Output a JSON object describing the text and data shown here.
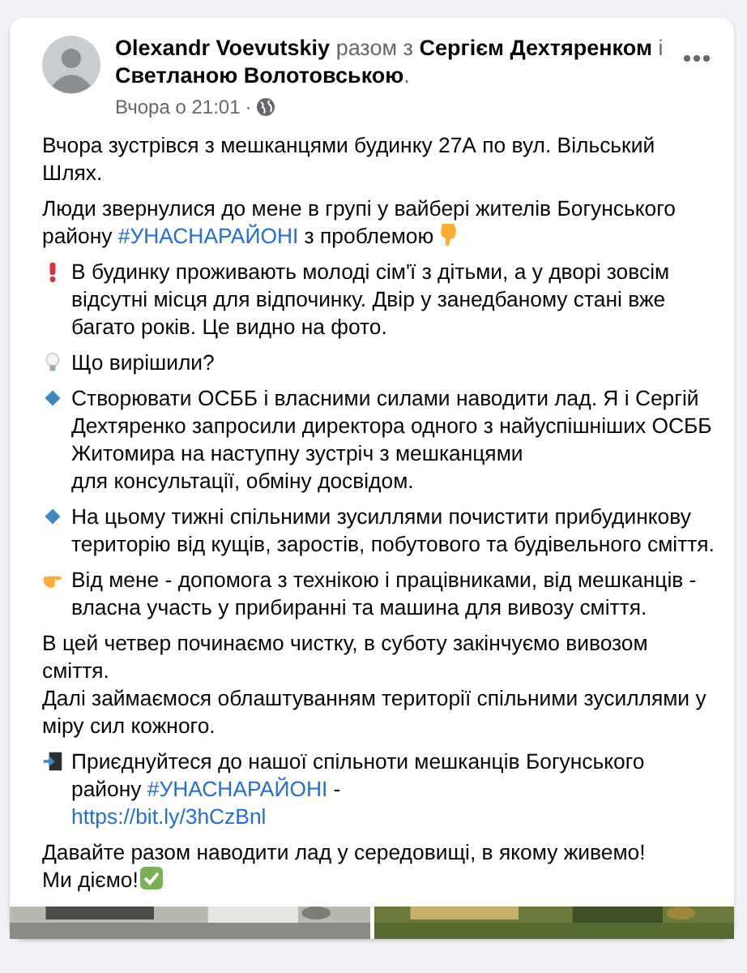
{
  "post": {
    "header_text": "**Olexandr Voevutskiy** разом з **Сергієм Дехтяренком** і **Светланою Волотовською**.",
    "timestamp": "Вчора о 21:01",
    "separator": "·",
    "paragraphs": [
      {
        "kind": "text",
        "lines": [
          [
            {
              "kind": "text",
              "text": "Вчора зустрівся з мешканцями будинку 27А по вул. Вільський Шлях."
            }
          ]
        ]
      },
      {
        "kind": "pointer",
        "lines": [
          [
            {
              "kind": "text",
              "text": "Люди звернулися до мене в групі у вайбері жителів Богунського"
            }
          ],
          [
            {
              "kind": "text",
              "text": "району "
            },
            {
              "kind": "hashtag",
              "text": "#УНАСНАРАЙОНІ"
            },
            {
              "kind": "text",
              "text": " з проблемою"
            }
          ]
        ]
      },
      {
        "kind": "alert",
        "lines": [
          [
            {
              "kind": "text",
              "text": "В будинку проживають молоді сім'ї з дітьми, а у дворі зовсім відсутні місця для відпочинку. Двір у занедбаному стані вже багато років. Це видно на фото."
            }
          ]
        ]
      },
      {
        "kind": "idea",
        "lines": [
          [
            {
              "kind": "text",
              "text": "Що вирішили?"
            }
          ]
        ]
      },
      {
        "kind": "point",
        "lines": [
          [
            {
              "kind": "text",
              "text": "Створювати ОСББ і власними силами наводити лад. Я і Сергій Дехтяренко запросили директора одного з найуспішніших ОСББ Житомира на наступну зустріч з мешканцями"
            }
          ],
          [
            {
              "kind": "text",
              "text": "для консультації, обміну досвідом."
            }
          ]
        ]
      },
      {
        "kind": "point",
        "lines": [
          [
            {
              "kind": "text",
              "text": "На цьому тижні спільними зусиллями почистити прибудинкову територію від кущів, заростів, побутового та будівельного сміття."
            }
          ]
        ]
      },
      {
        "kind": "action",
        "lines": [
          [
            {
              "kind": "text",
              "text": "Від мене - допомога з технікою і працівниками, від мешканців - власна участь у прибиранні та машина для вивозу сміття."
            }
          ]
        ]
      },
      {
        "kind": "text",
        "lines": [
          [
            {
              "kind": "text",
              "text": "В цей четвер починаємо чистку, в суботу закінчуємо вивозом сміття."
            }
          ],
          [
            {
              "kind": "text",
              "text": "Далі займаємося облаштуванням території спільними зусиллями у міру сил кожного."
            }
          ]
        ]
      },
      {
        "kind": "join",
        "lines": [
          [
            {
              "kind": "text",
              "text": "Приєднуйтеся до нашої спільноти мешканців Богунського району "
            },
            {
              "kind": "hashtag",
              "text": "#УНАСНАРАЙОНІ"
            },
            {
              "kind": "text",
              "text": " -"
            }
          ],
          [
            {
              "kind": "link",
              "text": "https://bit.ly/3hCzBnl"
            }
          ]
        ]
      },
      {
        "kind": "closing",
        "lines": [
          [
            {
              "kind": "text",
              "text": "Давайте разом наводити лад у середовищі, в якому живемо!"
            }
          ],
          [
            {
              "kind": "text",
              "text": "Ми діємо!"
            }
          ]
        ]
      }
    ]
  }
}
